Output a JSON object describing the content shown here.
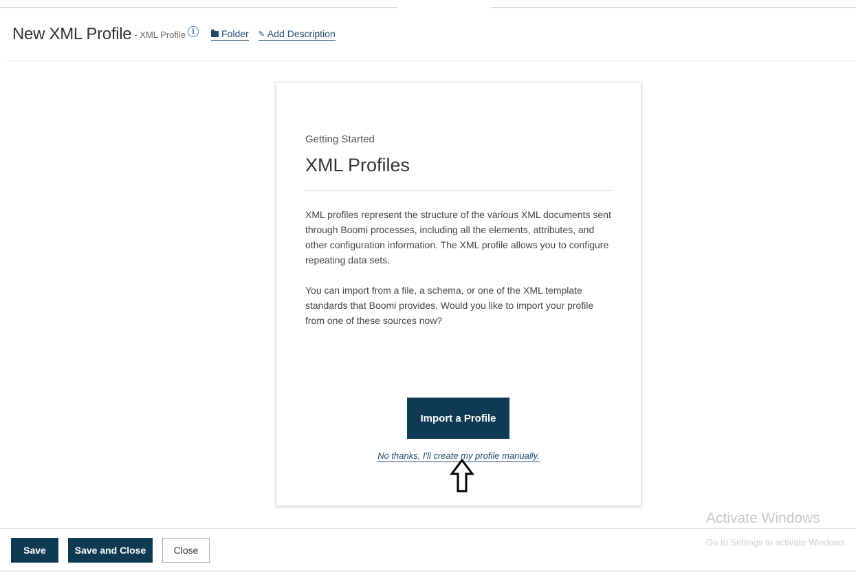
{
  "header": {
    "title": "New XML Profile",
    "subtitle": "- XML Profile",
    "info_icon": "i",
    "folder_link": "Folder",
    "add_description_link": "Add Description"
  },
  "card": {
    "kicker": "Getting Started",
    "title": "XML Profiles",
    "paragraph1": "XML profiles represent the structure of the various XML documents sent through Boomi processes, including all the elements, attributes, and other configuration information. The XML profile allows you to configure repeating data sets.",
    "paragraph2": "You can import from a file, a schema, or one of the XML template standards that Boomi provides. Would you like to import your profile from one of these sources now?",
    "import_button": "Import a Profile",
    "manual_link": "No thanks, I'll create my profile manually."
  },
  "footer": {
    "save": "Save",
    "save_and_close": "Save and Close",
    "close": "Close"
  },
  "watermark": {
    "title": "Activate Windows",
    "subtitle": "Go to Settings to activate Windows."
  },
  "colors": {
    "primary_button": "#0f3a54",
    "link": "#1f4a6e",
    "info_icon": "#3b7fc4"
  }
}
